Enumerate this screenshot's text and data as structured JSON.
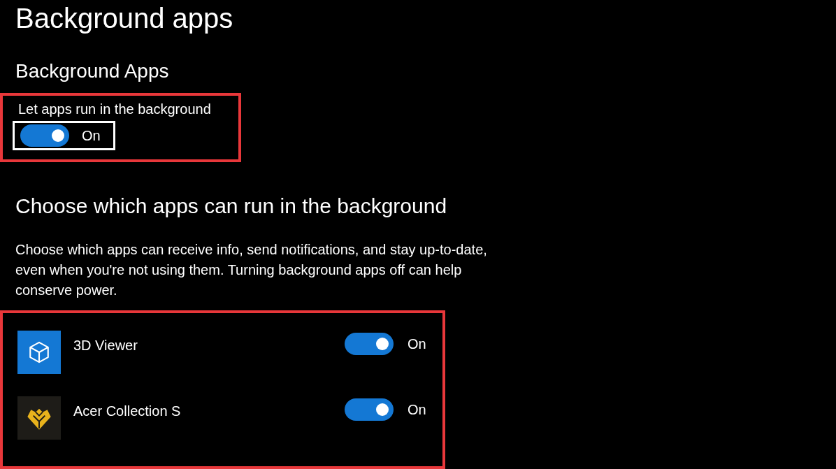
{
  "page_title": "Background apps",
  "section_title": "Background Apps",
  "master_toggle": {
    "label": "Let apps run in the background",
    "on": true,
    "state_text": "On",
    "highlighted": true,
    "focused": true
  },
  "apps_heading": "Choose which apps can run in the background",
  "description": "Choose which apps can receive info, send notifications, and stay up-to-date, even when you're not using them. Turning background apps off can help conserve power.",
  "apps_highlighted": true,
  "apps": [
    {
      "name": "3D Viewer",
      "kind": "cube",
      "on": true,
      "state_text": "On"
    },
    {
      "name": "Acer Collection S",
      "kind": "gem",
      "on": true,
      "state_text": "On"
    }
  ]
}
